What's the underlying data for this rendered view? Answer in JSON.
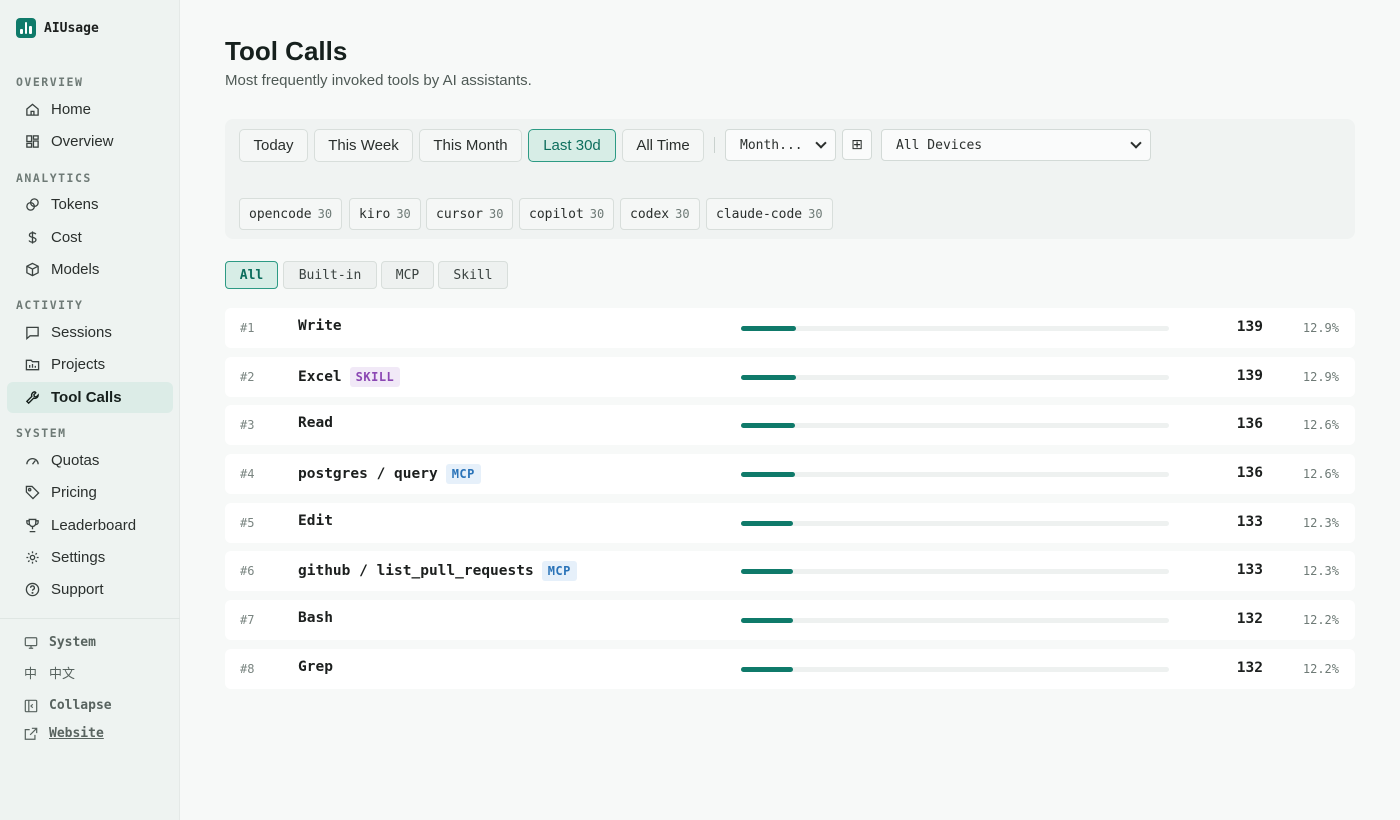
{
  "app": {
    "name": "AIUsage"
  },
  "sidebar": {
    "sections": {
      "overview": "OVERVIEW",
      "analytics": "ANALYTICS",
      "activity": "ACTIVITY",
      "system": "SYSTEM"
    },
    "items": {
      "home": "Home",
      "overview": "Overview",
      "tokens": "Tokens",
      "cost": "Cost",
      "models": "Models",
      "sessions": "Sessions",
      "projects": "Projects",
      "tool_calls": "Tool Calls",
      "quotas": "Quotas",
      "pricing": "Pricing",
      "leaderboard": "Leaderboard",
      "settings": "Settings",
      "support": "Support"
    },
    "footer": {
      "theme": "System",
      "language_glyph": "中",
      "language": "中文",
      "collapse": "Collapse",
      "website": "Website"
    }
  },
  "page": {
    "title": "Tool Calls",
    "subtitle": "Most frequently invoked tools by AI assistants."
  },
  "filters": {
    "ranges": [
      "Today",
      "This Week",
      "This Month",
      "Last 30d",
      "All Time"
    ],
    "active_range": "Last 30d",
    "granularity": "Month...",
    "grid_icon": "⊞",
    "devices": "All Devices",
    "clients": [
      {
        "name": "opencode",
        "count": "30"
      },
      {
        "name": "kiro",
        "count": "30"
      },
      {
        "name": "cursor",
        "count": "30"
      },
      {
        "name": "copilot",
        "count": "30"
      },
      {
        "name": "codex",
        "count": "30"
      },
      {
        "name": "claude-code",
        "count": "30"
      }
    ]
  },
  "type_tabs": [
    "All",
    "Built-in",
    "MCP",
    "Skill"
  ],
  "active_type_tab": "All",
  "accent_color": "#0f7a6a",
  "tools": [
    {
      "rank": "#1",
      "name": "Write",
      "badge": "",
      "count": "139",
      "pct": "12.9%",
      "share": 0.129
    },
    {
      "rank": "#2",
      "name": "Excel",
      "badge": "SKILL",
      "count": "139",
      "pct": "12.9%",
      "share": 0.129
    },
    {
      "rank": "#3",
      "name": "Read",
      "badge": "",
      "count": "136",
      "pct": "12.6%",
      "share": 0.126
    },
    {
      "rank": "#4",
      "name": "postgres / query",
      "badge": "MCP",
      "count": "136",
      "pct": "12.6%",
      "share": 0.126
    },
    {
      "rank": "#5",
      "name": "Edit",
      "badge": "",
      "count": "133",
      "pct": "12.3%",
      "share": 0.123
    },
    {
      "rank": "#6",
      "name": "github / list_pull_requests",
      "badge": "MCP",
      "count": "133",
      "pct": "12.3%",
      "share": 0.123
    },
    {
      "rank": "#7",
      "name": "Bash",
      "badge": "",
      "count": "132",
      "pct": "12.2%",
      "share": 0.122
    },
    {
      "rank": "#8",
      "name": "Grep",
      "badge": "",
      "count": "132",
      "pct": "12.2%",
      "share": 0.122
    }
  ]
}
